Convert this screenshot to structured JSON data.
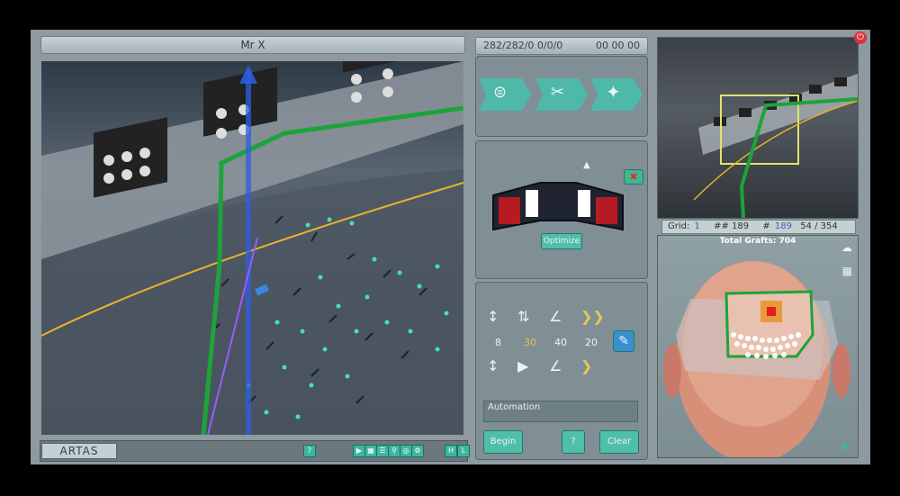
{
  "patient_name": "Mr X",
  "status": {
    "counts": "282/282/0 0/0/0",
    "time": "00 00 00"
  },
  "brand": "ARTAS",
  "bottom_buttons": [
    "?",
    "H",
    "L"
  ],
  "optimize_label": "Optimize",
  "params": {
    "values": [
      "8",
      "30",
      "40",
      "20"
    ]
  },
  "automation_label": "Automation",
  "buttons": {
    "begin": "Begin",
    "help": "?",
    "clear": "Clear"
  },
  "grid": {
    "label": "Grid:",
    "value": "1",
    "hash_hash": "## 189",
    "hash_value": "189",
    "fraction": "54 / 354"
  },
  "total_grafts": "Total Grafts: 704",
  "colors": {
    "accent": "#4fbfa9",
    "path": "#1ea33a",
    "hairline": "#e7b32a",
    "warning": "#d23a3a"
  }
}
